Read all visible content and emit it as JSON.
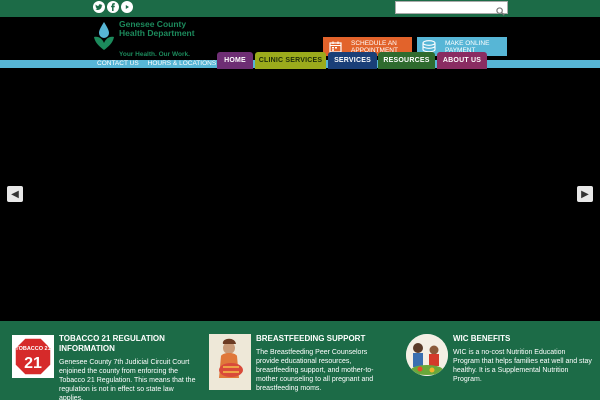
{
  "social": [
    {
      "icon": "twitter-icon"
    },
    {
      "icon": "facebook-icon"
    },
    {
      "icon": "youtube-icon"
    }
  ],
  "search": {
    "placeholder": "",
    "icon": "search-icon"
  },
  "logo": {
    "org_line1": "Genesee County",
    "org_line2": "Health Department",
    "tagline": "Your Health. Our Work."
  },
  "cta": {
    "schedule": {
      "line1": "SCHEDULE AN",
      "line2": "APPOINTMENT",
      "icon": "calendar-icon",
      "color": "#e2632b"
    },
    "pay": {
      "line1": "MAKE ONLINE",
      "line2": "PAYMENT",
      "icon": "payment-icon",
      "color": "#57b6d6"
    }
  },
  "sublinks": [
    "CONTACT US",
    "HOURS & LOCATIONS"
  ],
  "nav": [
    "HOME",
    "CLINIC SERVICES",
    "SERVICES",
    "RESOURCES",
    "ABOUT US"
  ],
  "slider": {
    "prev_icon": "chevron-left-icon",
    "next_icon": "chevron-right-icon"
  },
  "cards": [
    {
      "title": "TOBACCO 21 REGULATION INFORMATION",
      "body": "Genesee County 7th Judicial Circuit Court enjoined the county from enforcing the Tobacco 21 Regulation. This means that the regulation is not in effect so state law applies.",
      "image_text": "TOBACCO 21"
    },
    {
      "title": "BREASTFEEDING SUPPORT",
      "body": "The Breastfeeding Peer Counselors provide educational resources, breastfeeding support, and mother-to-mother counseling to all pregnant and breastfeeding moms."
    },
    {
      "title": "WIC BENEFITS",
      "body": "WIC is a no-cost Nutrition Education Program that helps families eat well and stay healthy. It is a Supplemental Nutrition Program."
    }
  ],
  "colors": {
    "brand_green": "#1c6b47",
    "accent_blue": "#57b6d6",
    "accent_orange": "#e2632b"
  }
}
